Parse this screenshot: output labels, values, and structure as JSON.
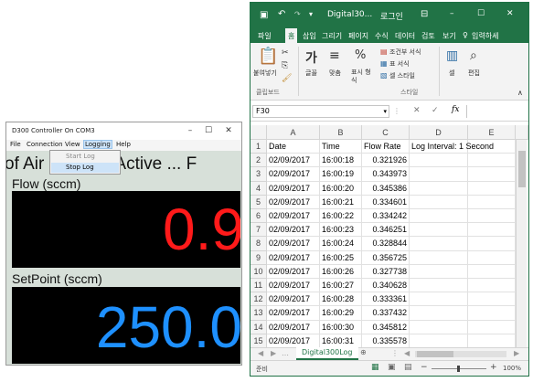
{
  "d300": {
    "title": "D300 Controller On COM3",
    "menu": [
      "File",
      "Connection",
      "View",
      "Logging",
      "Help"
    ],
    "logging_menu": {
      "start": "Start Log",
      "stop": "Stop Log"
    },
    "status_text": "of Air Logging Active ...  F",
    "flow_label": "Flow (sccm)",
    "flow_value": "0.9",
    "setpoint_label": "SetPoint (sccm)",
    "setpoint_value": "250.0",
    "colors": {
      "flow": "#ff1a1a",
      "setpoint": "#1e90ff",
      "panel": "#000000"
    }
  },
  "excel": {
    "title": "Digital30...",
    "account": "로그인",
    "tabs": [
      "파일",
      "홈",
      "삽입",
      "그리기",
      "페이지",
      "수식",
      "데이터",
      "검토",
      "보기"
    ],
    "tell_me": "입력하세",
    "ribbon": {
      "paste": "붙여넣기",
      "clipboard_group": "클립보드",
      "font": "글꼴",
      "align": "맞춤",
      "number": "표시 형식",
      "cond_format": "조건부 서식",
      "table_format": "표 서식",
      "cell_style": "셀 스타일",
      "style_group": "스타일",
      "cells": "셀",
      "edit": "편집"
    },
    "name_box": "F30",
    "formula_icon": "fx",
    "columns": [
      "A",
      "B",
      "C",
      "D",
      "E"
    ],
    "rows": [
      [
        "Date",
        "Time",
        "Flow Rate",
        "Log Interval: 1 Second",
        ""
      ],
      [
        "02/09/2017",
        "16:00:18",
        "0.321926",
        "",
        ""
      ],
      [
        "02/09/2017",
        "16:00:19",
        "0.343973",
        "",
        ""
      ],
      [
        "02/09/2017",
        "16:00:20",
        "0.345386",
        "",
        ""
      ],
      [
        "02/09/2017",
        "16:00:21",
        "0.334601",
        "",
        ""
      ],
      [
        "02/09/2017",
        "16:00:22",
        "0.334242",
        "",
        ""
      ],
      [
        "02/09/2017",
        "16:00:23",
        "0.346251",
        "",
        ""
      ],
      [
        "02/09/2017",
        "16:00:24",
        "0.328844",
        "",
        ""
      ],
      [
        "02/09/2017",
        "16:00:25",
        "0.356725",
        "",
        ""
      ],
      [
        "02/09/2017",
        "16:00:26",
        "0.327738",
        "",
        ""
      ],
      [
        "02/09/2017",
        "16:00:27",
        "0.340628",
        "",
        ""
      ],
      [
        "02/09/2017",
        "16:00:28",
        "0.333361",
        "",
        ""
      ],
      [
        "02/09/2017",
        "16:00:29",
        "0.337432",
        "",
        ""
      ],
      [
        "02/09/2017",
        "16:00:30",
        "0.345812",
        "",
        ""
      ],
      [
        "02/09/2017",
        "16:00:31",
        "0.335578",
        "",
        ""
      ]
    ],
    "sheet_tab": "Digital300Log",
    "status_left": "준비",
    "zoom": "100%",
    "accent": "#217346"
  }
}
